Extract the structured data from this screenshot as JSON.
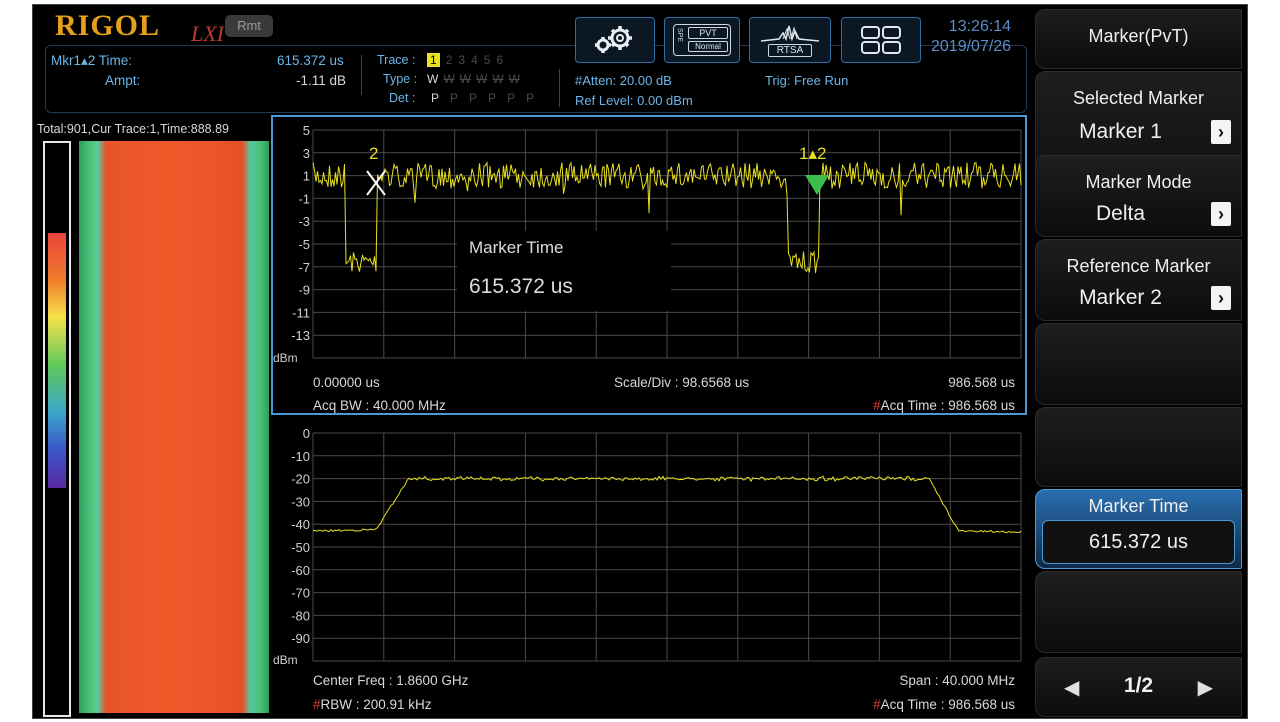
{
  "brand": {
    "logo": "RIGOL",
    "lxi": "LXI",
    "rmt": "Rmt"
  },
  "marker_readout": {
    "label1": "Mkr1▴2 Time:",
    "value1": "615.372 us",
    "label2": "Ampt:",
    "value2": "-1.11 dB"
  },
  "trace_info": {
    "trace_label": "Trace :",
    "trace_nums": [
      "1",
      "2",
      "3",
      "4",
      "5",
      "6"
    ],
    "type_label": "Type :",
    "type_first": "W",
    "type_rest": [
      "W",
      "W",
      "W",
      "W",
      "W"
    ],
    "det_label": "Det :",
    "det_first": "P",
    "det_rest": [
      "P",
      "P",
      "P",
      "P",
      "P"
    ]
  },
  "status": {
    "atten": "#Atten: 20.00 dB",
    "ref_level": "Ref Level: 0.00 dBm",
    "trig": "Trig: Free Run"
  },
  "toolbar": {
    "spe_line1": "PVT",
    "spe_line2": "Normal",
    "spe_side": "SPE",
    "rtsa": "RTSA"
  },
  "clock": {
    "time": "13:26:14",
    "date": "2019/07/26"
  },
  "spectrogram": {
    "header": "Total:901,Cur Trace:1,Time:888.89"
  },
  "pvt_plot": {
    "y_ticks": [
      "5",
      "3",
      "1",
      "-1",
      "-3",
      "-5",
      "-7",
      "-9",
      "-11",
      "-13"
    ],
    "y_unit": "dBm",
    "x_start": "0.00000 us",
    "scale_div": "Scale/Div : 98.6568 us",
    "x_stop": "986.568 us",
    "acq_bw": "Acq BW : 40.000 MHz",
    "acq_time_hash": "#",
    "acq_time": "Acq Time : 986.568 us",
    "marker2_label": "2",
    "marker1_label": "1▴2",
    "overlay_title": "Marker Time",
    "overlay_value": "615.372 us"
  },
  "spectrum_plot": {
    "y_ticks": [
      "0",
      "-10",
      "-20",
      "-30",
      "-40",
      "-50",
      "-60",
      "-70",
      "-80",
      "-90"
    ],
    "y_unit": "dBm",
    "center_freq": "Center Freq : 1.8600 GHz",
    "span": "Span : 40.000 MHz",
    "rbw_hash": "#",
    "rbw": "RBW : 200.91 kHz",
    "acq_time_hash": "#",
    "acq_time": "Acq Time : 986.568 us"
  },
  "softkeys": {
    "title": "Marker(PvT)",
    "selected_marker_label": "Selected Marker",
    "selected_marker_value": "Marker 1",
    "marker_mode_label": "Marker Mode",
    "marker_mode_value": "Delta",
    "reference_marker_label": "Reference Marker",
    "reference_marker_value": "Marker 2",
    "marker_time_label": "Marker Time",
    "marker_time_value": "615.372 us",
    "page": "1/2"
  },
  "colors": {
    "accent": "#4a9ad8",
    "trace": "#e8e020",
    "grid": "#4a4a4a",
    "marker_green": "#3bbf4a"
  }
}
